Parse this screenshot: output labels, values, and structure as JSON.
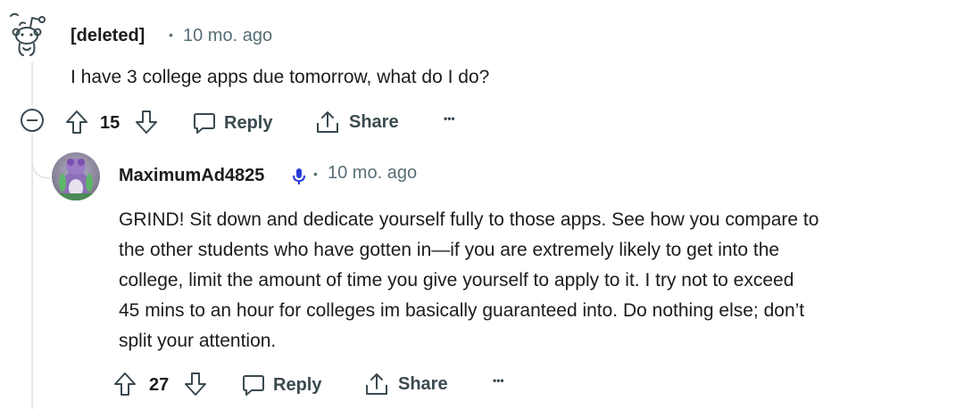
{
  "comment1": {
    "author": "[deleted]",
    "separator": "•",
    "time": "10 mo. ago",
    "body": "I have 3 college apps due tomorrow, what do I do?",
    "votes": "15",
    "reply_label": "Reply",
    "share_label": "Share",
    "more_label": "•••"
  },
  "comment2": {
    "author": "MaximumAd4825",
    "separator": "•",
    "time": "10 mo. ago",
    "body_lines": [
      "GRIND! Sit down and dedicate yourself fully to those apps. See how you compare to",
      "the other students who have gotten in—if you are extremely likely to get into the",
      "college, limit the amount of time you give yourself to apply to it. I try not to exceed",
      "45 mins to an hour for colleges im basically guaranteed into. Do nothing else; don’t",
      "split your attention."
    ],
    "votes": "27",
    "reply_label": "Reply",
    "share_label": "Share",
    "more_label": "•••"
  },
  "colors": {
    "text": "#1c1c1c",
    "meta": "#576f76",
    "action": "#3a4a50",
    "thread_line": "#e5e7ea",
    "mic_blue": "#2a3cd6"
  }
}
